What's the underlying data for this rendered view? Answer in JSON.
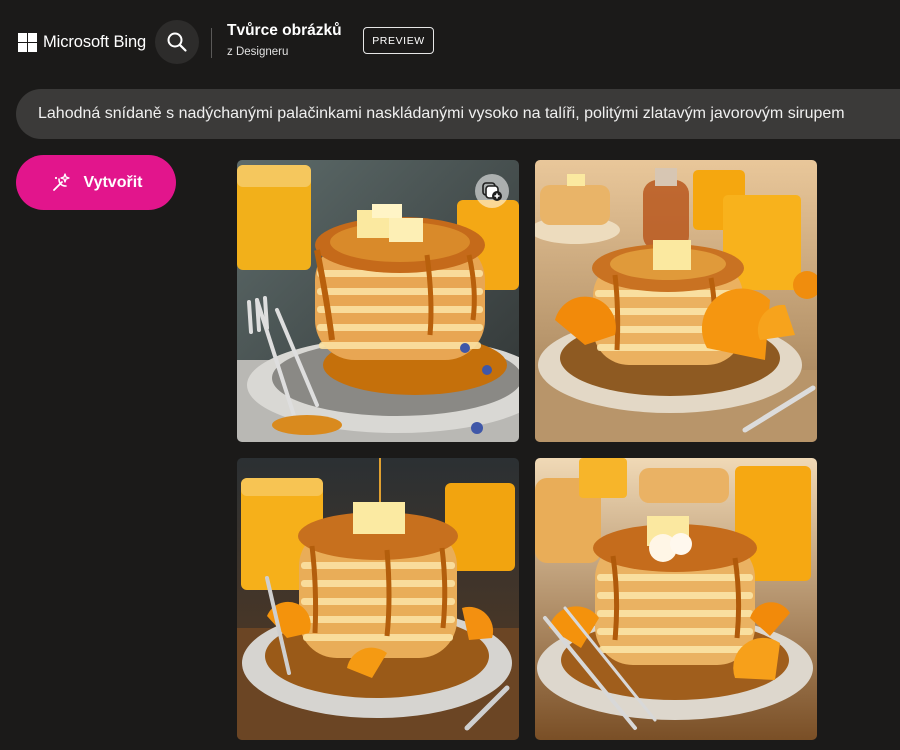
{
  "header": {
    "brand_name": "Microsoft Bing",
    "brand_logo": "microsoft-four-squares",
    "search_icon": "search-icon",
    "app_title": "Tvůrce obrázků",
    "app_subtitle": "z Designeru",
    "preview_badge": "PREVIEW"
  },
  "prompt": {
    "text": "Lahodná snídaně s nadýchanými palačinkami naskládanými vysoko na talíři, politými zlatavým javorovým sirupem"
  },
  "create_button": {
    "label": "Vytvořit",
    "icon": "magic-wand-icon",
    "color": "#e2158c"
  },
  "results": {
    "images": [
      {
        "subject": "pancake-stack-1",
        "has_save_icon": true
      },
      {
        "subject": "pancake-stack-2",
        "has_save_icon": false
      },
      {
        "subject": "pancake-stack-3",
        "has_save_icon": false
      },
      {
        "subject": "pancake-stack-4",
        "has_save_icon": false
      }
    ],
    "save_icon": "add-to-collection-icon"
  },
  "colors": {
    "background": "#1b1a19",
    "prompt_bar": "#3b3a39",
    "accent": "#e2158c"
  }
}
